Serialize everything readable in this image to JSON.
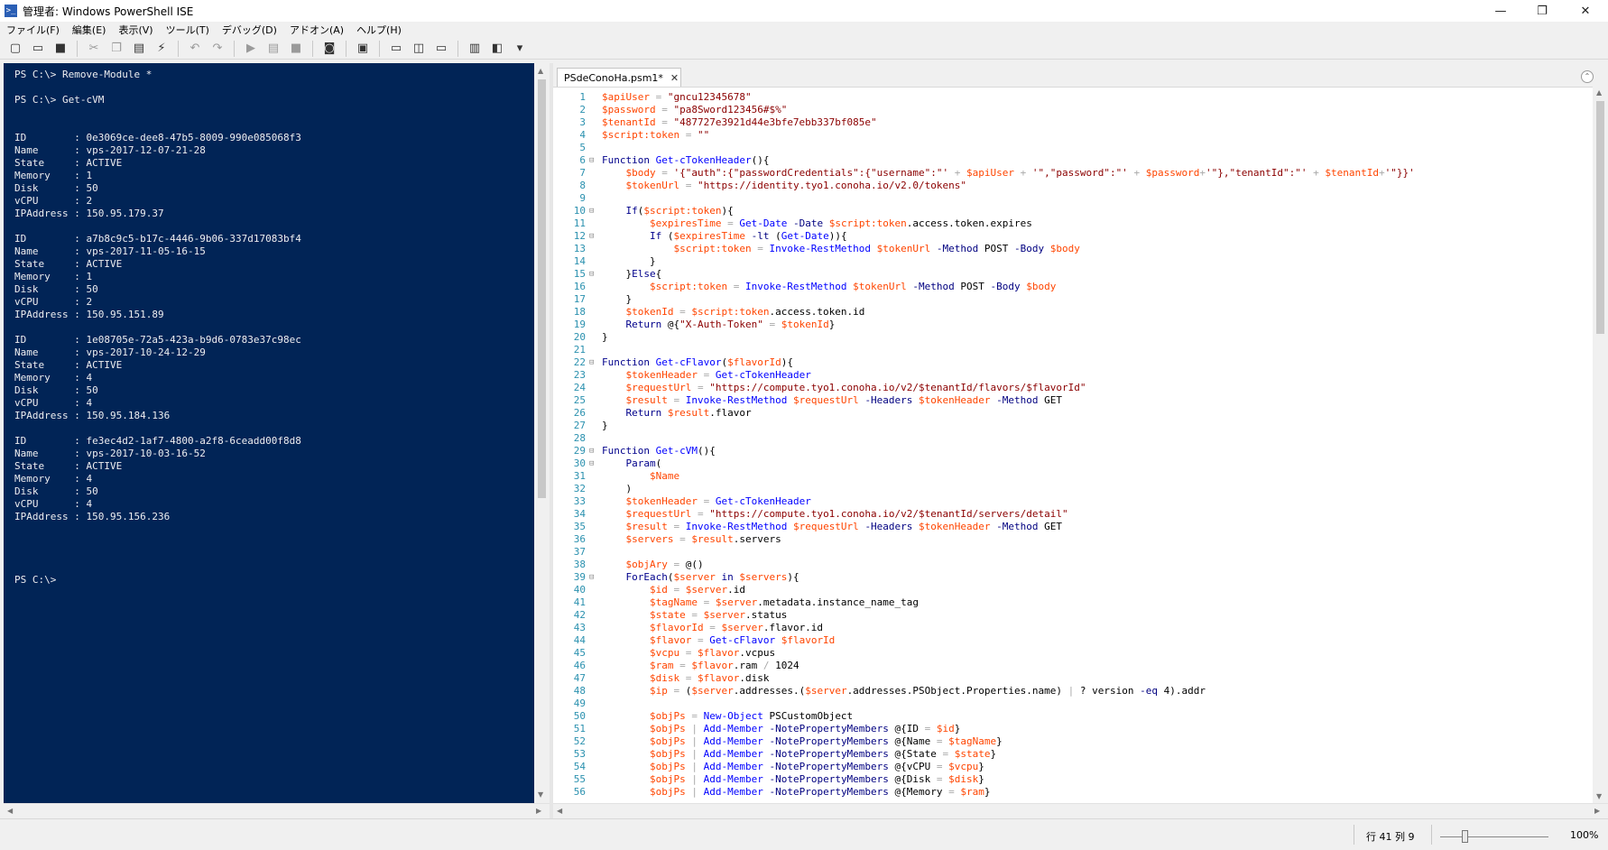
{
  "window": {
    "title": "管理者: Windows PowerShell ISE",
    "app_icon": "powershell-icon",
    "controls": [
      "—",
      "❐",
      "✕"
    ]
  },
  "menu": [
    "ファイル(F)",
    "編集(E)",
    "表示(V)",
    "ツール(T)",
    "デバッグ(D)",
    "アドオン(A)",
    "ヘルプ(H)"
  ],
  "toolbar": [
    {
      "icon": "new-file-icon",
      "glyph": "▢",
      "enabled": true
    },
    {
      "icon": "open-file-icon",
      "glyph": "▭",
      "enabled": true
    },
    {
      "icon": "save-icon",
      "glyph": "■",
      "enabled": true
    },
    {
      "sep": true
    },
    {
      "icon": "cut-icon",
      "glyph": "✂",
      "enabled": false
    },
    {
      "icon": "copy-icon",
      "glyph": "❐",
      "enabled": false
    },
    {
      "icon": "paste-icon",
      "glyph": "▤",
      "enabled": true
    },
    {
      "icon": "clear-console-icon",
      "glyph": "⚡",
      "enabled": true
    },
    {
      "sep": true
    },
    {
      "icon": "undo-icon",
      "glyph": "↶",
      "enabled": false
    },
    {
      "icon": "redo-icon",
      "glyph": "↷",
      "enabled": false
    },
    {
      "sep": true
    },
    {
      "icon": "run-icon",
      "glyph": "▶",
      "enabled": false
    },
    {
      "icon": "run-selection-icon",
      "glyph": "▤",
      "enabled": false
    },
    {
      "icon": "stop-icon",
      "glyph": "■",
      "enabled": false
    },
    {
      "sep": true
    },
    {
      "icon": "remote-tab-icon",
      "glyph": "◙",
      "enabled": true
    },
    {
      "sep": true
    },
    {
      "icon": "powershell-console-icon",
      "glyph": "▣",
      "enabled": true
    },
    {
      "sep": true
    },
    {
      "icon": "show-script-top-icon",
      "glyph": "▭",
      "enabled": true
    },
    {
      "icon": "show-script-right-icon",
      "glyph": "◫",
      "enabled": true
    },
    {
      "icon": "show-script-max-icon",
      "glyph": "▭",
      "enabled": true
    },
    {
      "sep": true
    },
    {
      "icon": "show-command-window-icon",
      "glyph": "▥",
      "enabled": true
    },
    {
      "icon": "show-addon-icon",
      "glyph": "◧",
      "enabled": true
    },
    {
      "icon": "toolbar-overflow-icon",
      "glyph": "▾",
      "enabled": true
    }
  ],
  "console": {
    "lines": [
      "PS C:\\> Remove-Module *",
      "",
      "PS C:\\> Get-cVM",
      "",
      "",
      "ID        : 0e3069ce-dee8-47b5-8009-990e085068f3",
      "Name      : vps-2017-12-07-21-28",
      "State     : ACTIVE",
      "Memory    : 1",
      "Disk      : 50",
      "vCPU      : 2",
      "IPAddress : 150.95.179.37",
      "",
      "ID        : a7b8c9c5-b17c-4446-9b06-337d17083bf4",
      "Name      : vps-2017-11-05-16-15",
      "State     : ACTIVE",
      "Memory    : 1",
      "Disk      : 50",
      "vCPU      : 2",
      "IPAddress : 150.95.151.89",
      "",
      "ID        : 1e08705e-72a5-423a-b9d6-0783e37c98ec",
      "Name      : vps-2017-10-24-12-29",
      "State     : ACTIVE",
      "Memory    : 4",
      "Disk      : 50",
      "vCPU      : 4",
      "IPAddress : 150.95.184.136",
      "",
      "ID        : fe3ec4d2-1af7-4800-a2f8-6ceadd00f8d8",
      "Name      : vps-2017-10-03-16-52",
      "State     : ACTIVE",
      "Memory    : 4",
      "Disk      : 50",
      "vCPU      : 4",
      "IPAddress : 150.95.156.236",
      "",
      "",
      "",
      "",
      "PS C:\\>"
    ]
  },
  "editor": {
    "tab_label": "PSdeConoHa.psm1*",
    "tab_close": "✕",
    "collapse_glyph": "⌃",
    "lines": [
      {
        "n": "1",
        "fold": "",
        "text": "$apiUser = \"gncu12345678\""
      },
      {
        "n": "2",
        "fold": "",
        "text": "$password = \"pa8Sword123456#$%\""
      },
      {
        "n": "3",
        "fold": "",
        "text": "$tenantId = \"487727e3921d44e3bfe7ebb337bf085e\""
      },
      {
        "n": "4",
        "fold": "",
        "text": "$script:token = \"\""
      },
      {
        "n": "5",
        "fold": "",
        "text": ""
      },
      {
        "n": "6",
        "fold": "⊟",
        "text": "Function Get-cTokenHeader(){"
      },
      {
        "n": "7",
        "fold": "",
        "text": "    $body = '{\"auth\":{\"passwordCredentials\":{\"username\":\"' + $apiUser + '\",\"password\":\"' + $password+'\"},\"tenantId\":\"' + $tenantId+'\"}}'"
      },
      {
        "n": "8",
        "fold": "",
        "text": "    $tokenUrl = \"https://identity.tyo1.conoha.io/v2.0/tokens\""
      },
      {
        "n": "9",
        "fold": "",
        "text": ""
      },
      {
        "n": "10",
        "fold": "⊟",
        "text": "    If($script:token){"
      },
      {
        "n": "11",
        "fold": "",
        "text": "        $expiresTime = Get-Date -Date $script:token.access.token.expires"
      },
      {
        "n": "12",
        "fold": "⊟",
        "text": "        If ($expiresTime -lt (Get-Date)){"
      },
      {
        "n": "13",
        "fold": "",
        "text": "            $script:token = Invoke-RestMethod $tokenUrl -Method POST -Body $body"
      },
      {
        "n": "14",
        "fold": "",
        "text": "        }"
      },
      {
        "n": "15",
        "fold": "⊟",
        "text": "    }Else{"
      },
      {
        "n": "16",
        "fold": "",
        "text": "        $script:token = Invoke-RestMethod $tokenUrl -Method POST -Body $body"
      },
      {
        "n": "17",
        "fold": "",
        "text": "    }"
      },
      {
        "n": "18",
        "fold": "",
        "text": "    $tokenId = $script:token.access.token.id"
      },
      {
        "n": "19",
        "fold": "",
        "text": "    Return @{\"X-Auth-Token\" = $tokenId}"
      },
      {
        "n": "20",
        "fold": "",
        "text": "}"
      },
      {
        "n": "21",
        "fold": "",
        "text": ""
      },
      {
        "n": "22",
        "fold": "⊟",
        "text": "Function Get-cFlavor($flavorId){"
      },
      {
        "n": "23",
        "fold": "",
        "text": "    $tokenHeader = Get-cTokenHeader"
      },
      {
        "n": "24",
        "fold": "",
        "text": "    $requestUrl = \"https://compute.tyo1.conoha.io/v2/$tenantId/flavors/$flavorId\""
      },
      {
        "n": "25",
        "fold": "",
        "text": "    $result = Invoke-RestMethod $requestUrl -Headers $tokenHeader -Method GET"
      },
      {
        "n": "26",
        "fold": "",
        "text": "    Return $result.flavor"
      },
      {
        "n": "27",
        "fold": "",
        "text": "}"
      },
      {
        "n": "28",
        "fold": "",
        "text": ""
      },
      {
        "n": "29",
        "fold": "⊟",
        "text": "Function Get-cVM(){"
      },
      {
        "n": "30",
        "fold": "⊟",
        "text": "    Param("
      },
      {
        "n": "31",
        "fold": "",
        "text": "        $Name"
      },
      {
        "n": "32",
        "fold": "",
        "text": "    )"
      },
      {
        "n": "33",
        "fold": "",
        "text": "    $tokenHeader = Get-cTokenHeader"
      },
      {
        "n": "34",
        "fold": "",
        "text": "    $requestUrl = \"https://compute.tyo1.conoha.io/v2/$tenantId/servers/detail\""
      },
      {
        "n": "35",
        "fold": "",
        "text": "    $result = Invoke-RestMethod $requestUrl -Headers $tokenHeader -Method GET"
      },
      {
        "n": "36",
        "fold": "",
        "text": "    $servers = $result.servers"
      },
      {
        "n": "37",
        "fold": "",
        "text": ""
      },
      {
        "n": "38",
        "fold": "",
        "text": "    $objAry = @()"
      },
      {
        "n": "39",
        "fold": "⊟",
        "text": "    ForEach($server in $servers){"
      },
      {
        "n": "40",
        "fold": "",
        "text": "        $id = $server.id"
      },
      {
        "n": "41",
        "fold": "",
        "text": "        $tagName = $server.metadata.instance_name_tag"
      },
      {
        "n": "42",
        "fold": "",
        "text": "        $state = $server.status"
      },
      {
        "n": "43",
        "fold": "",
        "text": "        $flavorId = $server.flavor.id"
      },
      {
        "n": "44",
        "fold": "",
        "text": "        $flavor = Get-cFlavor $flavorId"
      },
      {
        "n": "45",
        "fold": "",
        "text": "        $vcpu = $flavor.vcpus"
      },
      {
        "n": "46",
        "fold": "",
        "text": "        $ram = $flavor.ram / 1024"
      },
      {
        "n": "47",
        "fold": "",
        "text": "        $disk = $flavor.disk"
      },
      {
        "n": "48",
        "fold": "",
        "text": "        $ip = ($server.addresses.($server.addresses.PSObject.Properties.name) | ? version -eq 4).addr"
      },
      {
        "n": "49",
        "fold": "",
        "text": ""
      },
      {
        "n": "50",
        "fold": "",
        "text": "        $objPs = New-Object PSCustomObject"
      },
      {
        "n": "51",
        "fold": "",
        "text": "        $objPs | Add-Member -NotePropertyMembers @{ID = $id}"
      },
      {
        "n": "52",
        "fold": "",
        "text": "        $objPs | Add-Member -NotePropertyMembers @{Name = $tagName}"
      },
      {
        "n": "53",
        "fold": "",
        "text": "        $objPs | Add-Member -NotePropertyMembers @{State = $state}"
      },
      {
        "n": "54",
        "fold": "",
        "text": "        $objPs | Add-Member -NotePropertyMembers @{vCPU = $vcpu}"
      },
      {
        "n": "55",
        "fold": "",
        "text": "        $objPs | Add-Member -NotePropertyMembers @{Disk = $disk}"
      },
      {
        "n": "56",
        "fold": "",
        "text": "        $objPs | Add-Member -NotePropertyMembers @{Memory = $ram}"
      }
    ]
  },
  "status": {
    "position": "行 41 列 9",
    "zoom": "100%",
    "zoom_level_percent": 100
  },
  "colors": {
    "console_bg": "#012456",
    "console_fg": "#eeedf0",
    "variable": "#ff4500",
    "command": "#0000ff",
    "string": "#8b0000",
    "keyword": "#00008b",
    "operator": "#a9a9a9",
    "parameter": "#000080",
    "member": "#000000",
    "line_number": "#2b91af"
  }
}
